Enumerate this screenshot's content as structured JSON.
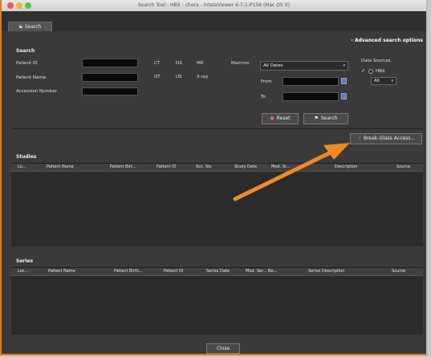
{
  "window": {
    "title": "Search Tool - HBX - chera - IntelaViewer 4-7-1-P158 (Mac OS X)"
  },
  "tabs": [
    {
      "label": "Search",
      "icon": "binoculars-icon"
    }
  ],
  "advanced_link": "Advanced search options",
  "search": {
    "title": "Search",
    "labels": {
      "patient_id": "Patient ID",
      "patient_name": "Patient Name",
      "accession": "Accession Number"
    },
    "modalities_label": "Mammo",
    "modalities": [
      "CT",
      "DX",
      "MR",
      "OT",
      "US",
      "X-ray"
    ],
    "scope_select": "All Dates",
    "from_label": "From",
    "to_label": "To",
    "reset_label": "Reset",
    "search_label": "Search",
    "data_sources_title": "Data Sources",
    "data_source_option": "HBX",
    "data_source_select": "All"
  },
  "break_glass_label": "Break-Glass Access...",
  "studies": {
    "title": "Studies",
    "columns": [
      "Lo...",
      "Patient Name",
      "Patient Birt...",
      "Patient ID",
      "Acc. No.",
      "Study Date",
      "Mod. Sr...",
      "Description",
      "Source"
    ]
  },
  "series": {
    "title": "Series",
    "columns": [
      "Loc...",
      "Patient Name",
      "Patient Birth...",
      "Patient ID",
      "Series Date",
      "Mod. Ser... No...",
      "Series Description",
      "Source"
    ]
  },
  "close_label": "Close",
  "colors": {
    "accent": "#e3791e",
    "arrow": "#f08a24",
    "panel_bg": "#3a3a3a"
  }
}
